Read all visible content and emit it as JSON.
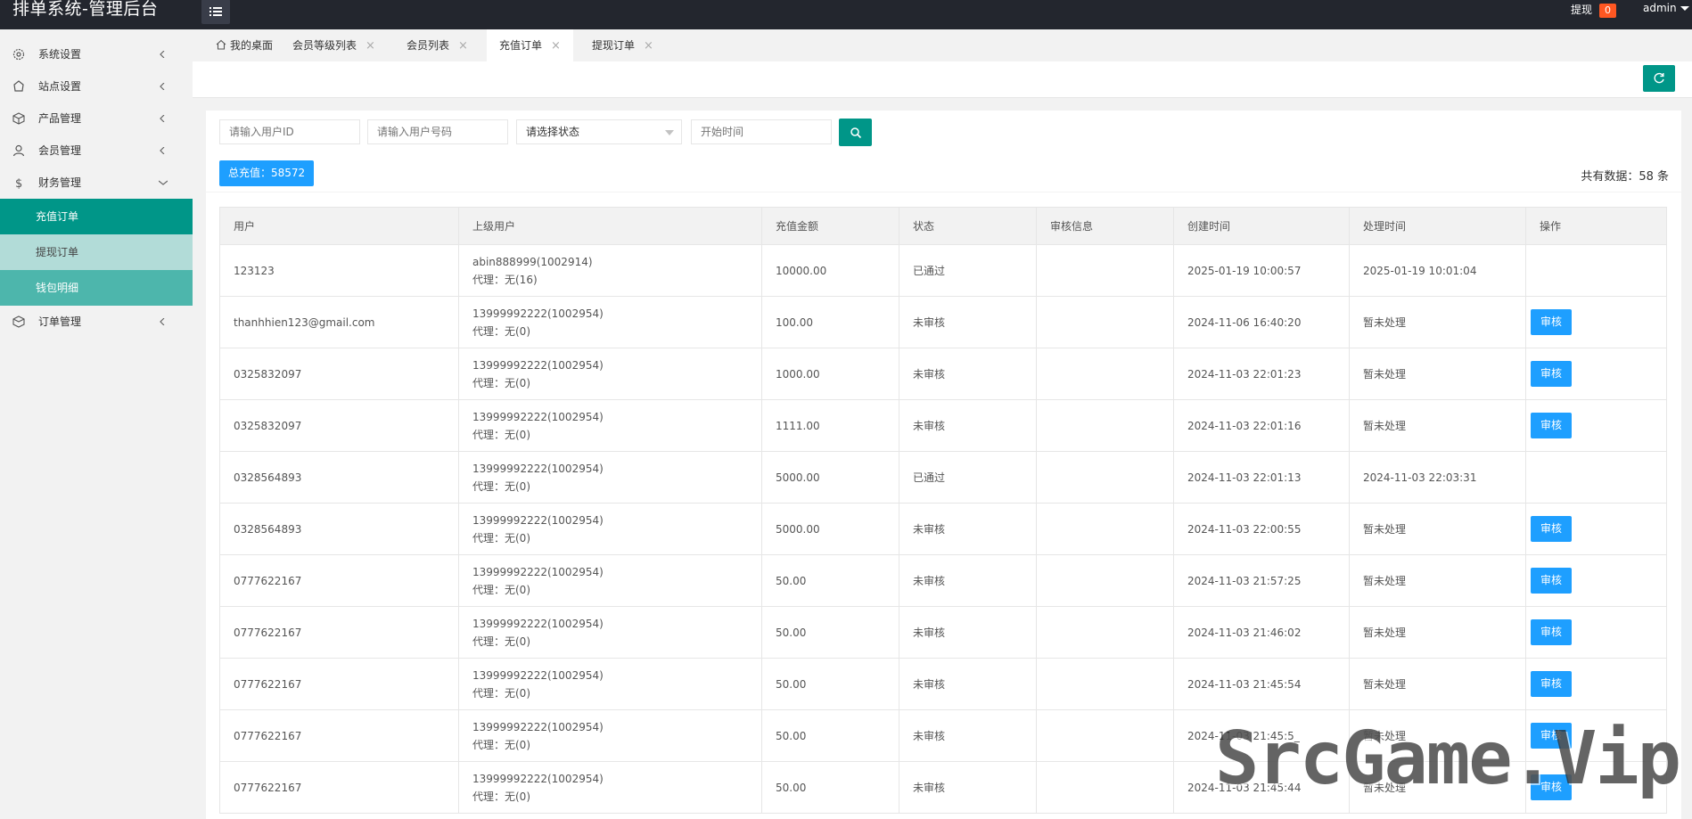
{
  "header": {
    "title": "排单系统-管理后台",
    "withdraw_label": "提现",
    "withdraw_count": "0",
    "user_name": "admin"
  },
  "sidebar": {
    "items": [
      {
        "label": "系统设置",
        "icon": "gear-icon"
      },
      {
        "label": "站点设置",
        "icon": "site-icon"
      },
      {
        "label": "产品管理",
        "icon": "box-icon"
      },
      {
        "label": "会员管理",
        "icon": "user-icon"
      },
      {
        "label": "财务管理",
        "icon": "dollar-icon",
        "expanded": true
      },
      {
        "label": "订单管理",
        "icon": "orders-icon"
      }
    ],
    "sub_items": [
      "充值订单",
      "提现订单",
      "钱包明细"
    ]
  },
  "tabs": [
    {
      "label": "我的桌面",
      "closable": false
    },
    {
      "label": "会员等级列表",
      "closable": true
    },
    {
      "label": "会员列表",
      "closable": true
    },
    {
      "label": "充值订单",
      "closable": true,
      "active": true
    },
    {
      "label": "提现订单",
      "closable": true
    }
  ],
  "filters": {
    "user_id_placeholder": "请输入用户ID",
    "user_phone_placeholder": "请输入用户号码",
    "status_select": "请选择状态",
    "start_time_placeholder": "开始时间"
  },
  "summary": {
    "total_label": "总充值：58572",
    "count_label": "共有数据：58 条"
  },
  "table": {
    "columns": [
      "用户",
      "上级用户",
      "充值金额",
      "状态",
      "审核信息",
      "创建时间",
      "处理时间",
      "操作"
    ],
    "audit_label": "审核",
    "rows": [
      {
        "user": "123123",
        "parent": "abin888999(1002914)",
        "agent": "代理：无(16)",
        "amount": "10000.00",
        "status": "已通过",
        "audit_info": "",
        "created": "2025-01-19 10:00:57",
        "processed": "2025-01-19 10:01:04",
        "action": false
      },
      {
        "user": "thanhhien123@gmail.com",
        "parent": "13999992222(1002954)",
        "agent": "代理：无(0)",
        "amount": "100.00",
        "status": "未审核",
        "audit_info": "",
        "created": "2024-11-06 16:40:20",
        "processed": "暂未处理",
        "action": true
      },
      {
        "user": "0325832097",
        "parent": "13999992222(1002954)",
        "agent": "代理：无(0)",
        "amount": "1000.00",
        "status": "未审核",
        "audit_info": "",
        "created": "2024-11-03 22:01:23",
        "processed": "暂未处理",
        "action": true
      },
      {
        "user": "0325832097",
        "parent": "13999992222(1002954)",
        "agent": "代理：无(0)",
        "amount": "1111.00",
        "status": "未审核",
        "audit_info": "",
        "created": "2024-11-03 22:01:16",
        "processed": "暂未处理",
        "action": true
      },
      {
        "user": "0328564893",
        "parent": "13999992222(1002954)",
        "agent": "代理：无(0)",
        "amount": "5000.00",
        "status": "已通过",
        "audit_info": "",
        "created": "2024-11-03 22:01:13",
        "processed": "2024-11-03 22:03:31",
        "action": false
      },
      {
        "user": "0328564893",
        "parent": "13999992222(1002954)",
        "agent": "代理：无(0)",
        "amount": "5000.00",
        "status": "未审核",
        "audit_info": "",
        "created": "2024-11-03 22:00:55",
        "processed": "暂未处理",
        "action": true
      },
      {
        "user": "0777622167",
        "parent": "13999992222(1002954)",
        "agent": "代理：无(0)",
        "amount": "50.00",
        "status": "未审核",
        "audit_info": "",
        "created": "2024-11-03 21:57:25",
        "processed": "暂未处理",
        "action": true
      },
      {
        "user": "0777622167",
        "parent": "13999992222(1002954)",
        "agent": "代理：无(0)",
        "amount": "50.00",
        "status": "未审核",
        "audit_info": "",
        "created": "2024-11-03 21:46:02",
        "processed": "暂未处理",
        "action": true
      },
      {
        "user": "0777622167",
        "parent": "13999992222(1002954)",
        "agent": "代理：无(0)",
        "amount": "50.00",
        "status": "未审核",
        "audit_info": "",
        "created": "2024-11-03 21:45:54",
        "processed": "暂未处理",
        "action": true
      },
      {
        "user": "0777622167",
        "parent": "13999992222(1002954)",
        "agent": "代理：无(0)",
        "amount": "50.00",
        "status": "未审核",
        "audit_info": "",
        "created": "2024-11-03 21:45:5_",
        "processed": "暂未处理",
        "action": true
      },
      {
        "user": "0777622167",
        "parent": "13999992222(1002954)",
        "agent": "代理：无(0)",
        "amount": "50.00",
        "status": "未审核",
        "audit_info": "",
        "created": "2024-11-03 21:45:44",
        "processed": "暂未处理",
        "action": true
      }
    ]
  },
  "watermark": "SrcGame.Vip",
  "colors": {
    "primary": "#009688",
    "blue": "#1e9fff",
    "header": "#23262e",
    "badge": "#ff5722"
  }
}
